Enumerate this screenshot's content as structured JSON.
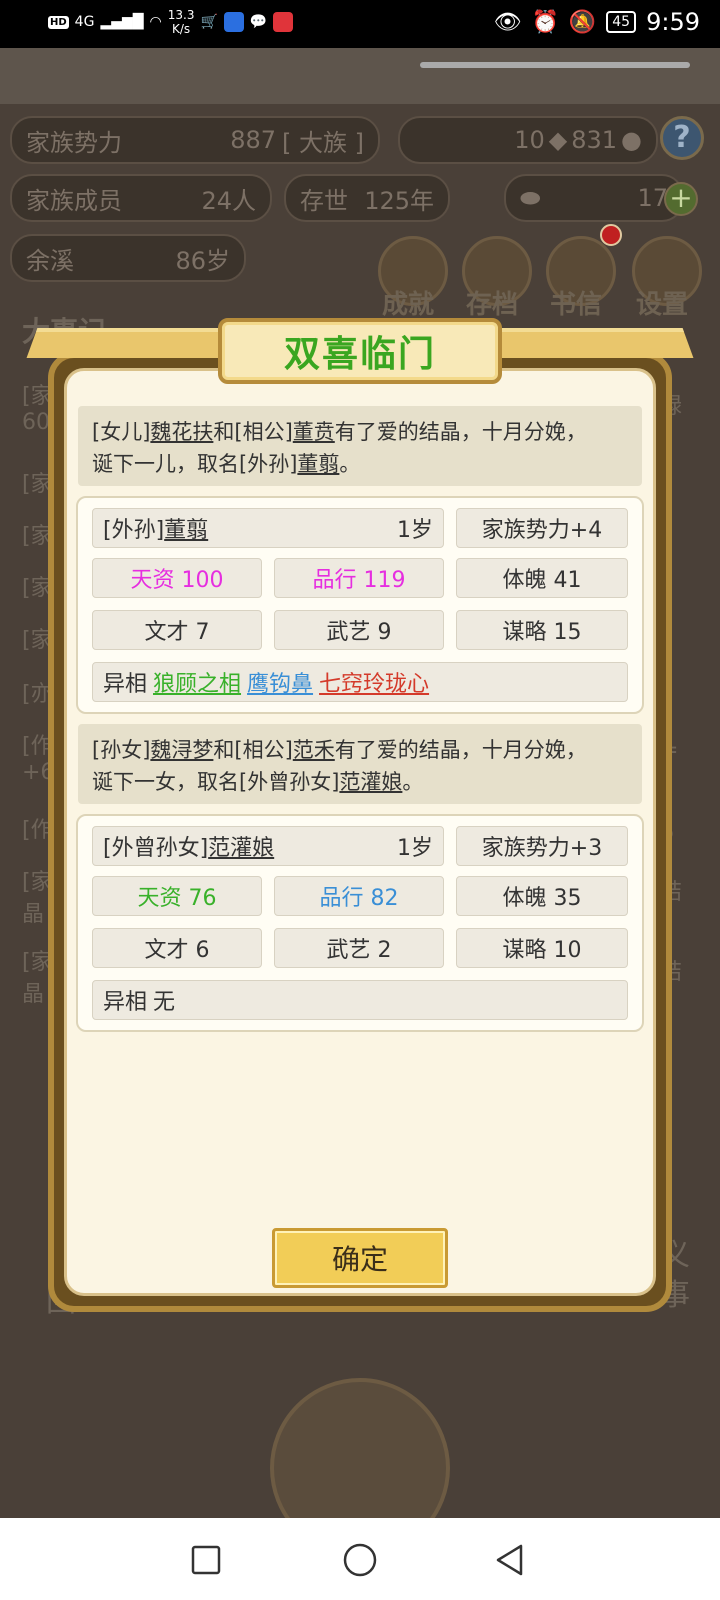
{
  "status_bar": {
    "network": "4G",
    "speed": "13.3",
    "speed_unit": "K/s",
    "battery": "45",
    "time": "9:59"
  },
  "background": {
    "family_power_label": "家族势力",
    "family_power_value": "887",
    "family_power_rank": "[ 大族 ]",
    "stone_count": "10",
    "coin_count": "831",
    "members_label": "家族成员",
    "members_value": "24人",
    "years_label": "存世",
    "years_value": "125年",
    "gold_count": "17",
    "leader_name": "余溪",
    "leader_age": "86岁",
    "menu": [
      "成就",
      "存档",
      "书信",
      "设置"
    ],
    "section_title": "大事记",
    "log_fragments_left": [
      "[家",
      "60",
      "[家",
      "[家",
      "[家",
      "[家",
      "[亦",
      "[作",
      "+6",
      "[作",
      "[家",
      "晶",
      "[家",
      "晶"
    ],
    "log_fragments_right": [
      "禄",
      "=",
      "6",
      "结",
      "结"
    ],
    "bottom_fragments": [
      "义",
      "事",
      "回"
    ]
  },
  "dialog": {
    "title": "双喜临门",
    "event1": {
      "prefix1": "[女儿]",
      "parent1": "魏花扶",
      "mid": "和[相公]",
      "parent2": "董贲",
      "rest1": "有了爱的结晶，十月分娩，",
      "rest2": "诞下一儿，取名[外孙]",
      "child": "董翦",
      "end": "。"
    },
    "child1": {
      "relation": "[外孙]",
      "name": "董翦",
      "age": "1岁",
      "power": "家族势力+4",
      "talent": "天资 100",
      "conduct": "品行 119",
      "physique": "体魄 41",
      "literacy": "文才 7",
      "martial": "武艺 9",
      "strategy": "谋略 15",
      "traits_label": "异相",
      "traits": [
        "狼顾之相",
        "鹰钩鼻",
        "七窍玲珑心"
      ]
    },
    "event2": {
      "prefix1": "[孙女]",
      "parent1": "魏浔梦",
      "mid": "和[相公]",
      "parent2": "范禾",
      "rest1": "有了爱的结晶，十月分娩，",
      "rest2": "诞下一女，取名[外曾孙女]",
      "child": "范灌娘",
      "end": "。"
    },
    "child2": {
      "relation": "[外曾孙女]",
      "name": "范灌娘",
      "age": "1岁",
      "power": "家族势力+3",
      "talent": "天资 76",
      "conduct": "品行 82",
      "physique": "体魄 35",
      "literacy": "文才 6",
      "martial": "武艺 2",
      "strategy": "谋略 10",
      "traits_label": "异相",
      "traits_none": "无"
    },
    "confirm_label": "确定"
  },
  "colors": {
    "title_green": "#3aa620",
    "talent_magenta": "#e62ee0",
    "trait_green": "#39b12a",
    "trait_blue": "#3a8fd6",
    "trait_red": "#d43a2a"
  }
}
